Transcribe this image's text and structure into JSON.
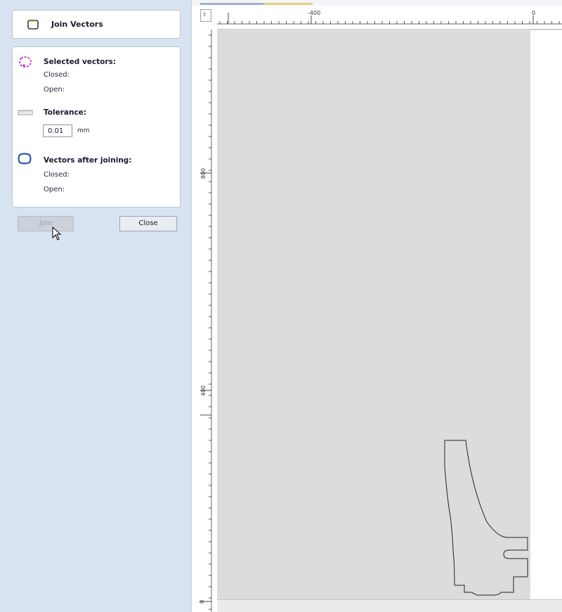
{
  "panel": {
    "title": "Join Vectors",
    "selected": {
      "heading": "Selected vectors:",
      "closed_label": "Closed:",
      "open_label": "Open:"
    },
    "tolerance": {
      "heading": "Tolerance:",
      "value": "0.01",
      "unit": "mm"
    },
    "after": {
      "heading": "Vectors after joining:",
      "closed_label": "Closed:",
      "open_label": "Open:"
    },
    "buttons": {
      "join": "Join",
      "close": "Close"
    }
  },
  "rulers": {
    "horizontal_labels": [
      "-400",
      "0"
    ],
    "vertical_labels": [
      "800",
      "400",
      "0"
    ]
  },
  "icons": {
    "title": "join-vectors-icon",
    "selected": "selected-vectors-icon",
    "tolerance": "ruler-icon",
    "after": "joined-vectors-icon",
    "cursor": "mouse-cursor-icon"
  },
  "colors": {
    "panel_bg": "#d7e3f0",
    "workspace_bg": "#dcdcdc",
    "selected_icon": "#d63bd0",
    "joined_icon": "#2a56b8"
  }
}
